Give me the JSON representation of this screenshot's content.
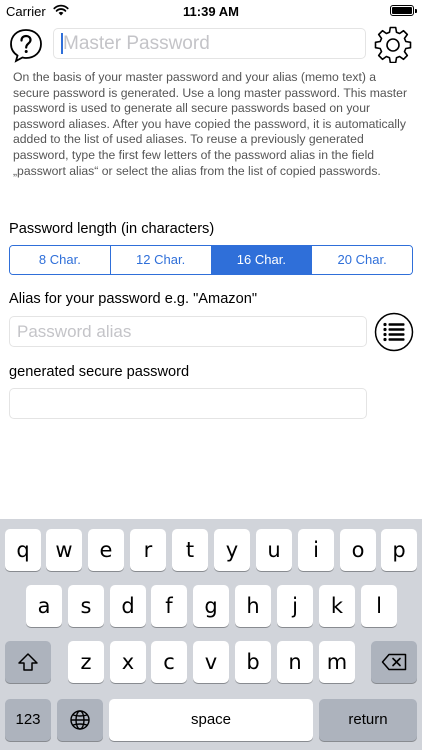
{
  "status_bar": {
    "carrier": "Carrier",
    "time": "11:39 AM"
  },
  "header": {
    "help_icon": "help-bubble-icon",
    "settings_icon": "gear-icon",
    "master_password": {
      "value": "",
      "placeholder": "Master Password"
    }
  },
  "description": "On the basis of your master password and your alias (memo text) a secure password is generated. Use a long master password. This master password is used to generate all secure passwords based on your password aliases. After you have copied the password, it is automatically added to the list of used aliases. To reuse a previously generated password, type the first few letters of the password alias in the field „passwort alias“  or select the alias from the list of copied passwords.",
  "password_length": {
    "label": "Password length (in characters)",
    "options": [
      "8 Char.",
      "12 Char.",
      "16 Char.",
      "20 Char."
    ],
    "selected": "16 Char."
  },
  "alias": {
    "label": "Alias for your password e.g. \"Amazon\"",
    "value": "",
    "placeholder": "Password alias",
    "list_icon": "list-icon"
  },
  "generated": {
    "label": "generated secure password",
    "value": ""
  },
  "keyboard": {
    "row1": [
      "q",
      "w",
      "e",
      "r",
      "t",
      "y",
      "u",
      "i",
      "o",
      "p"
    ],
    "row2": [
      "a",
      "s",
      "d",
      "f",
      "g",
      "h",
      "j",
      "k",
      "l"
    ],
    "row3": [
      "z",
      "x",
      "c",
      "v",
      "b",
      "n",
      "m"
    ],
    "numbers_label": "123",
    "space_label": "space",
    "return_label": "return",
    "shift_icon": "shift-icon",
    "backspace_icon": "backspace-icon",
    "globe_icon": "globe-icon"
  },
  "colors": {
    "accent": "#2f6fd9",
    "keyboard_bg": "#d1d4da",
    "dark_key": "#adb3bd"
  }
}
